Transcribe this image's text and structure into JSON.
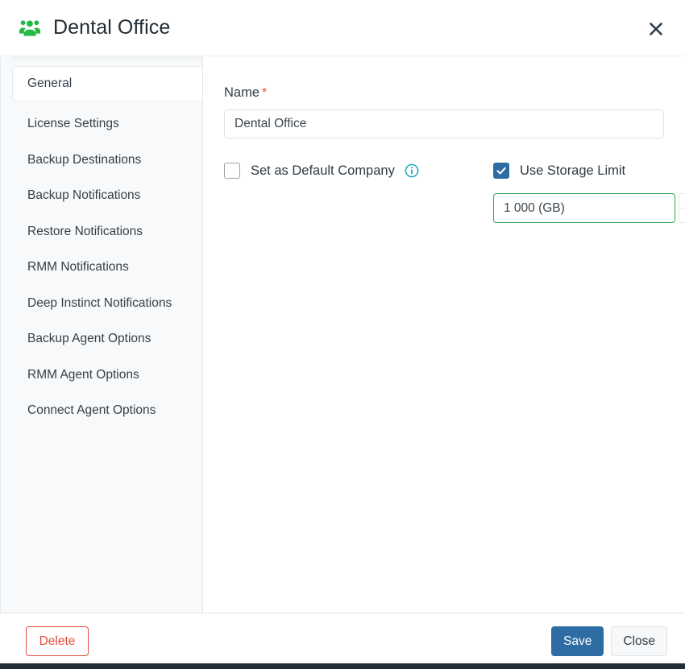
{
  "header": {
    "title": "Dental Office",
    "icon": "users-group-icon",
    "close_label": "✕",
    "icon_color": "#21ba45"
  },
  "sidebar": {
    "items": [
      {
        "label": "General",
        "active": true
      },
      {
        "label": "License Settings",
        "active": false
      },
      {
        "label": "Backup Destinations",
        "active": false
      },
      {
        "label": "Backup Notifications",
        "active": false
      },
      {
        "label": "Restore Notifications",
        "active": false
      },
      {
        "label": "RMM Notifications",
        "active": false
      },
      {
        "label": "Deep Instinct Notifications",
        "active": false
      },
      {
        "label": "Backup Agent Options",
        "active": false
      },
      {
        "label": "RMM Agent Options",
        "active": false
      },
      {
        "label": "Connect Agent Options",
        "active": false
      }
    ]
  },
  "form": {
    "name_label": "Name",
    "required_marker": "*",
    "name_value": "Dental Office",
    "name_placeholder": "Name",
    "default_company": {
      "label": "Set as Default Company",
      "checked": false,
      "info_icon": "info-circle-icon"
    },
    "storage_limit": {
      "label": "Use Storage Limit",
      "checked": true,
      "value": "1 000 (GB)",
      "placeholder": "(GB)",
      "increment_label": "+",
      "decrement_label": "–"
    }
  },
  "footer": {
    "delete_label": "Delete",
    "save_label": "Save",
    "close_label": "Close"
  },
  "colors": {
    "primary": "#2e6da4",
    "danger": "#e74c3c",
    "success": "#2ea44f",
    "info": "#1ba5b8",
    "brand_green": "#21ba45"
  }
}
